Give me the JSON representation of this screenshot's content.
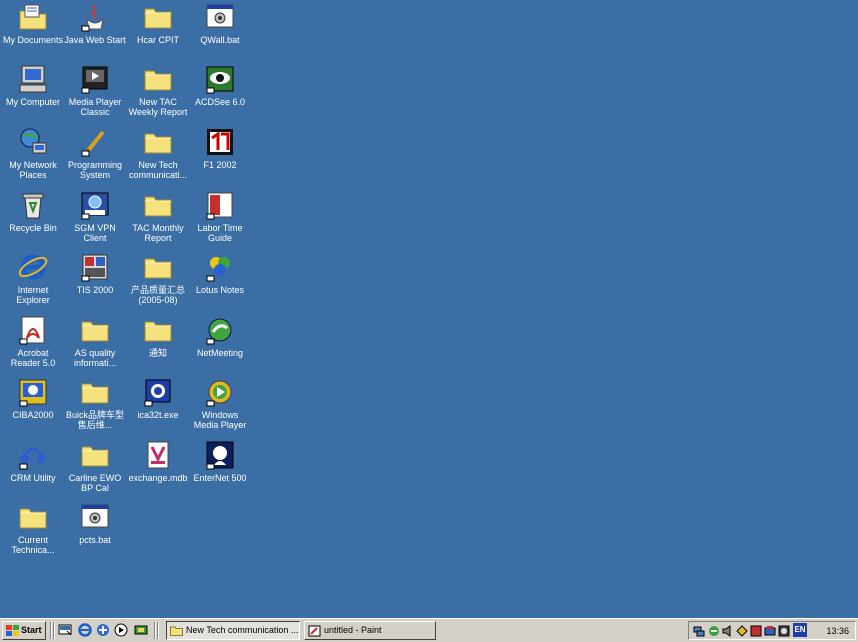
{
  "desktop": {
    "background_color": "#3b6ea5",
    "icons": [
      {
        "label": "My Documents",
        "icon": "my-documents-icon"
      },
      {
        "label": "Java Web Start",
        "icon": "java-web-start-icon"
      },
      {
        "label": "Hcar CPIT",
        "icon": "folder-icon"
      },
      {
        "label": "QWall.bat",
        "icon": "batch-file-icon"
      },
      {
        "label": "My Computer",
        "icon": "my-computer-icon"
      },
      {
        "label": "Media Player Classic",
        "icon": "media-player-classic-icon"
      },
      {
        "label": "New TAC Weekly Report",
        "icon": "folder-icon"
      },
      {
        "label": "ACDSee 6.0",
        "icon": "acdsee-icon"
      },
      {
        "label": "My Network Places",
        "icon": "network-places-icon"
      },
      {
        "label": "Programming System",
        "icon": "programming-system-icon"
      },
      {
        "label": "New Tech communicati...",
        "icon": "folder-icon"
      },
      {
        "label": "F1 2002",
        "icon": "f1-2002-icon"
      },
      {
        "label": "Recycle Bin",
        "icon": "recycle-bin-icon"
      },
      {
        "label": "SGM VPN Client",
        "icon": "vpn-client-icon"
      },
      {
        "label": "TAC Monthly Report",
        "icon": "folder-icon"
      },
      {
        "label": "Labor Time Guide",
        "icon": "labor-time-guide-icon"
      },
      {
        "label": "Internet Explorer",
        "icon": "internet-explorer-icon"
      },
      {
        "label": "TIS 2000",
        "icon": "tis-2000-icon"
      },
      {
        "label": "产品质量汇总(2005-08)",
        "icon": "folder-icon"
      },
      {
        "label": "Lotus Notes",
        "icon": "lotus-notes-icon"
      },
      {
        "label": "Acrobat Reader 5.0",
        "icon": "acrobat-reader-icon"
      },
      {
        "label": "AS quality informati...",
        "icon": "folder-icon"
      },
      {
        "label": "通知",
        "icon": "folder-icon"
      },
      {
        "label": "NetMeeting",
        "icon": "netmeeting-icon"
      },
      {
        "label": "CIBA2000",
        "icon": "ciba2000-icon"
      },
      {
        "label": "Buick品牌车型售后维...",
        "icon": "folder-icon"
      },
      {
        "label": "ica32t.exe",
        "icon": "ica32t-exe-icon"
      },
      {
        "label": "Windows Media Player",
        "icon": "windows-media-player-icon"
      },
      {
        "label": "CRM Utility",
        "icon": "crm-utility-icon"
      },
      {
        "label": "Carline EWO BP Cal",
        "icon": "folder-icon"
      },
      {
        "label": "exchange.mdb",
        "icon": "access-database-icon"
      },
      {
        "label": "EnterNet 500",
        "icon": "enternet-500-icon"
      },
      {
        "label": "Current Technica...",
        "icon": "folder-icon"
      },
      {
        "label": "pcts.bat",
        "icon": "batch-file-icon"
      }
    ]
  },
  "taskbar": {
    "start_label": "Start",
    "quick_launch": [
      "show-desktop-icon",
      "internet-explorer-icon",
      "outlook-express-icon",
      "media-player-icon",
      "app-icon"
    ],
    "tasks": [
      {
        "label": "New Tech communication ...",
        "icon": "folder-icon",
        "active": true
      },
      {
        "label": "untitled - Paint",
        "icon": "paint-icon",
        "active": false
      }
    ],
    "tray_icons": [
      "network-icon",
      "update-icon",
      "volume-icon",
      "security-icon",
      "app-tray-icon",
      "app-tray-icon-2",
      "app-tray-icon-3"
    ],
    "language": "EN",
    "clock": "13:36"
  }
}
